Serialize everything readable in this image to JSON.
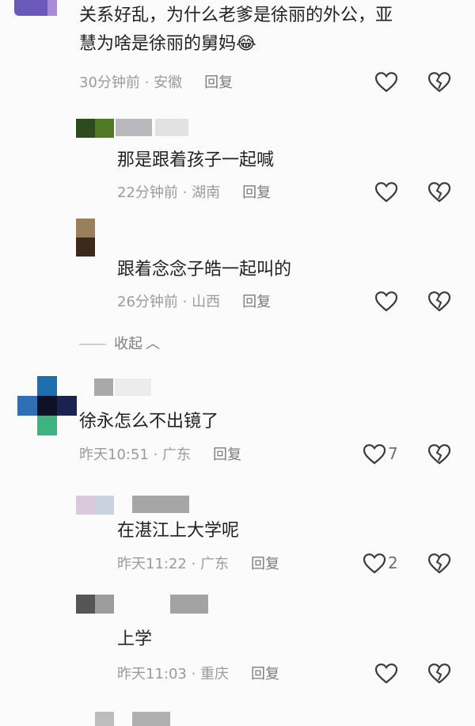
{
  "comments": [
    {
      "text_line1": "关系好乱，为什么老爹是徐丽的外公，亚",
      "text_line2": "慧为啥是徐丽的舅妈",
      "emoji": "😂",
      "time": "30分钟前",
      "location": "安徽",
      "reply_label": "回复",
      "like_count": ""
    },
    {
      "text": "那是跟着孩子一起喊",
      "time": "22分钟前",
      "location": "湖南",
      "reply_label": "回复",
      "like_count": ""
    },
    {
      "text": "跟着念念子皓一起叫的",
      "time": "26分钟前",
      "location": "山西",
      "reply_label": "回复",
      "like_count": ""
    },
    {
      "text": "徐永怎么不出镜了",
      "time": "昨天10:51",
      "location": "广东",
      "reply_label": "回复",
      "like_count": "7"
    },
    {
      "text": "在湛江上大学呢",
      "time": "昨天11:22",
      "location": "广东",
      "reply_label": "回复",
      "like_count": "2"
    },
    {
      "text": "上学",
      "time": "昨天11:03",
      "location": "重庆",
      "reply_label": "回复",
      "like_count": ""
    }
  ],
  "collapse_label": "收起",
  "separator": " · ",
  "colors": {
    "text": "#222222",
    "meta": "#9b9b9b",
    "icon": "#3a3a3a"
  }
}
